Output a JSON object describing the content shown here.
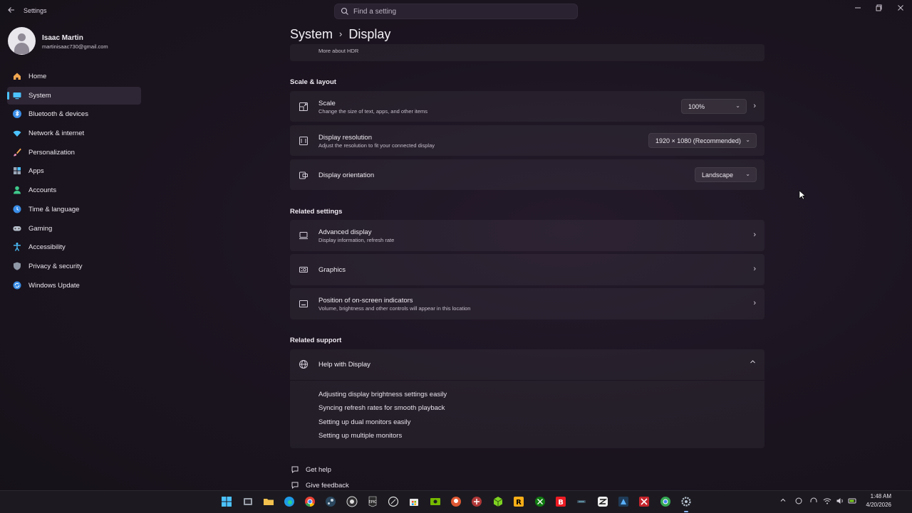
{
  "window": {
    "title": "Settings"
  },
  "search": {
    "placeholder": "Find a setting"
  },
  "profile": {
    "name": "Isaac Martin",
    "email": "martinisaac730@gmail.com"
  },
  "sidebar": {
    "items": [
      {
        "label": "Home",
        "icon": "home-icon"
      },
      {
        "label": "System",
        "icon": "system-icon",
        "active": true
      },
      {
        "label": "Bluetooth & devices",
        "icon": "bluetooth-icon"
      },
      {
        "label": "Network & internet",
        "icon": "network-icon"
      },
      {
        "label": "Personalization",
        "icon": "brush-icon"
      },
      {
        "label": "Apps",
        "icon": "apps-icon"
      },
      {
        "label": "Accounts",
        "icon": "accounts-icon"
      },
      {
        "label": "Time & language",
        "icon": "globe-clock-icon"
      },
      {
        "label": "Gaming",
        "icon": "gamepad-icon"
      },
      {
        "label": "Accessibility",
        "icon": "accessibility-icon"
      },
      {
        "label": "Privacy & security",
        "icon": "shield-icon"
      },
      {
        "label": "Windows Update",
        "icon": "update-icon"
      }
    ]
  },
  "breadcrumb": {
    "parent": "System",
    "separator": "›",
    "current": "Display"
  },
  "hdr_card": {
    "link": "More about HDR"
  },
  "scale_layout": {
    "title": "Scale & layout",
    "scale": {
      "title": "Scale",
      "subtitle": "Change the size of text, apps, and other items",
      "value": "100%"
    },
    "resolution": {
      "title": "Display resolution",
      "subtitle": "Adjust the resolution to fit your connected display",
      "value": "1920 × 1080 (Recommended)"
    },
    "orientation": {
      "title": "Display orientation",
      "value": "Landscape"
    }
  },
  "related_settings": {
    "title": "Related settings",
    "advanced": {
      "title": "Advanced display",
      "subtitle": "Display information, refresh rate"
    },
    "graphics": {
      "title": "Graphics"
    },
    "position": {
      "title": "Position of on-screen indicators",
      "subtitle": "Volume, brightness and other controls will appear in this location"
    }
  },
  "related_support": {
    "title": "Related support",
    "help": {
      "title": "Help with Display",
      "links": [
        "Adjusting display brightness settings easily",
        "Syncing refresh rates for smooth playback",
        "Setting up dual monitors easily",
        "Setting up multiple monitors"
      ]
    }
  },
  "footer": {
    "get_help": "Get help",
    "give_feedback": "Give feedback"
  },
  "taskbar": {
    "time": "1:48 AM",
    "date": "4/20/2026",
    "apps": [
      "start-icon",
      "task-view-icon",
      "file-explorer-icon",
      "edge-icon",
      "chrome-icon",
      "steam-icon",
      "obs-icon",
      "epic-games-icon",
      "app-icon",
      "store-icon",
      "nvidia-icon",
      "duckduckgo-icon",
      "app-icon",
      "cube-icon",
      "rockstar-icon",
      "xbox-icon",
      "bitdefender-icon",
      "app-icon",
      "capcut-icon",
      "app-icon",
      "app-icon",
      "chrome-beta-icon",
      "settings-icon"
    ]
  },
  "colors": {
    "accent": "#4cc2ff",
    "background": "#1c1521"
  }
}
